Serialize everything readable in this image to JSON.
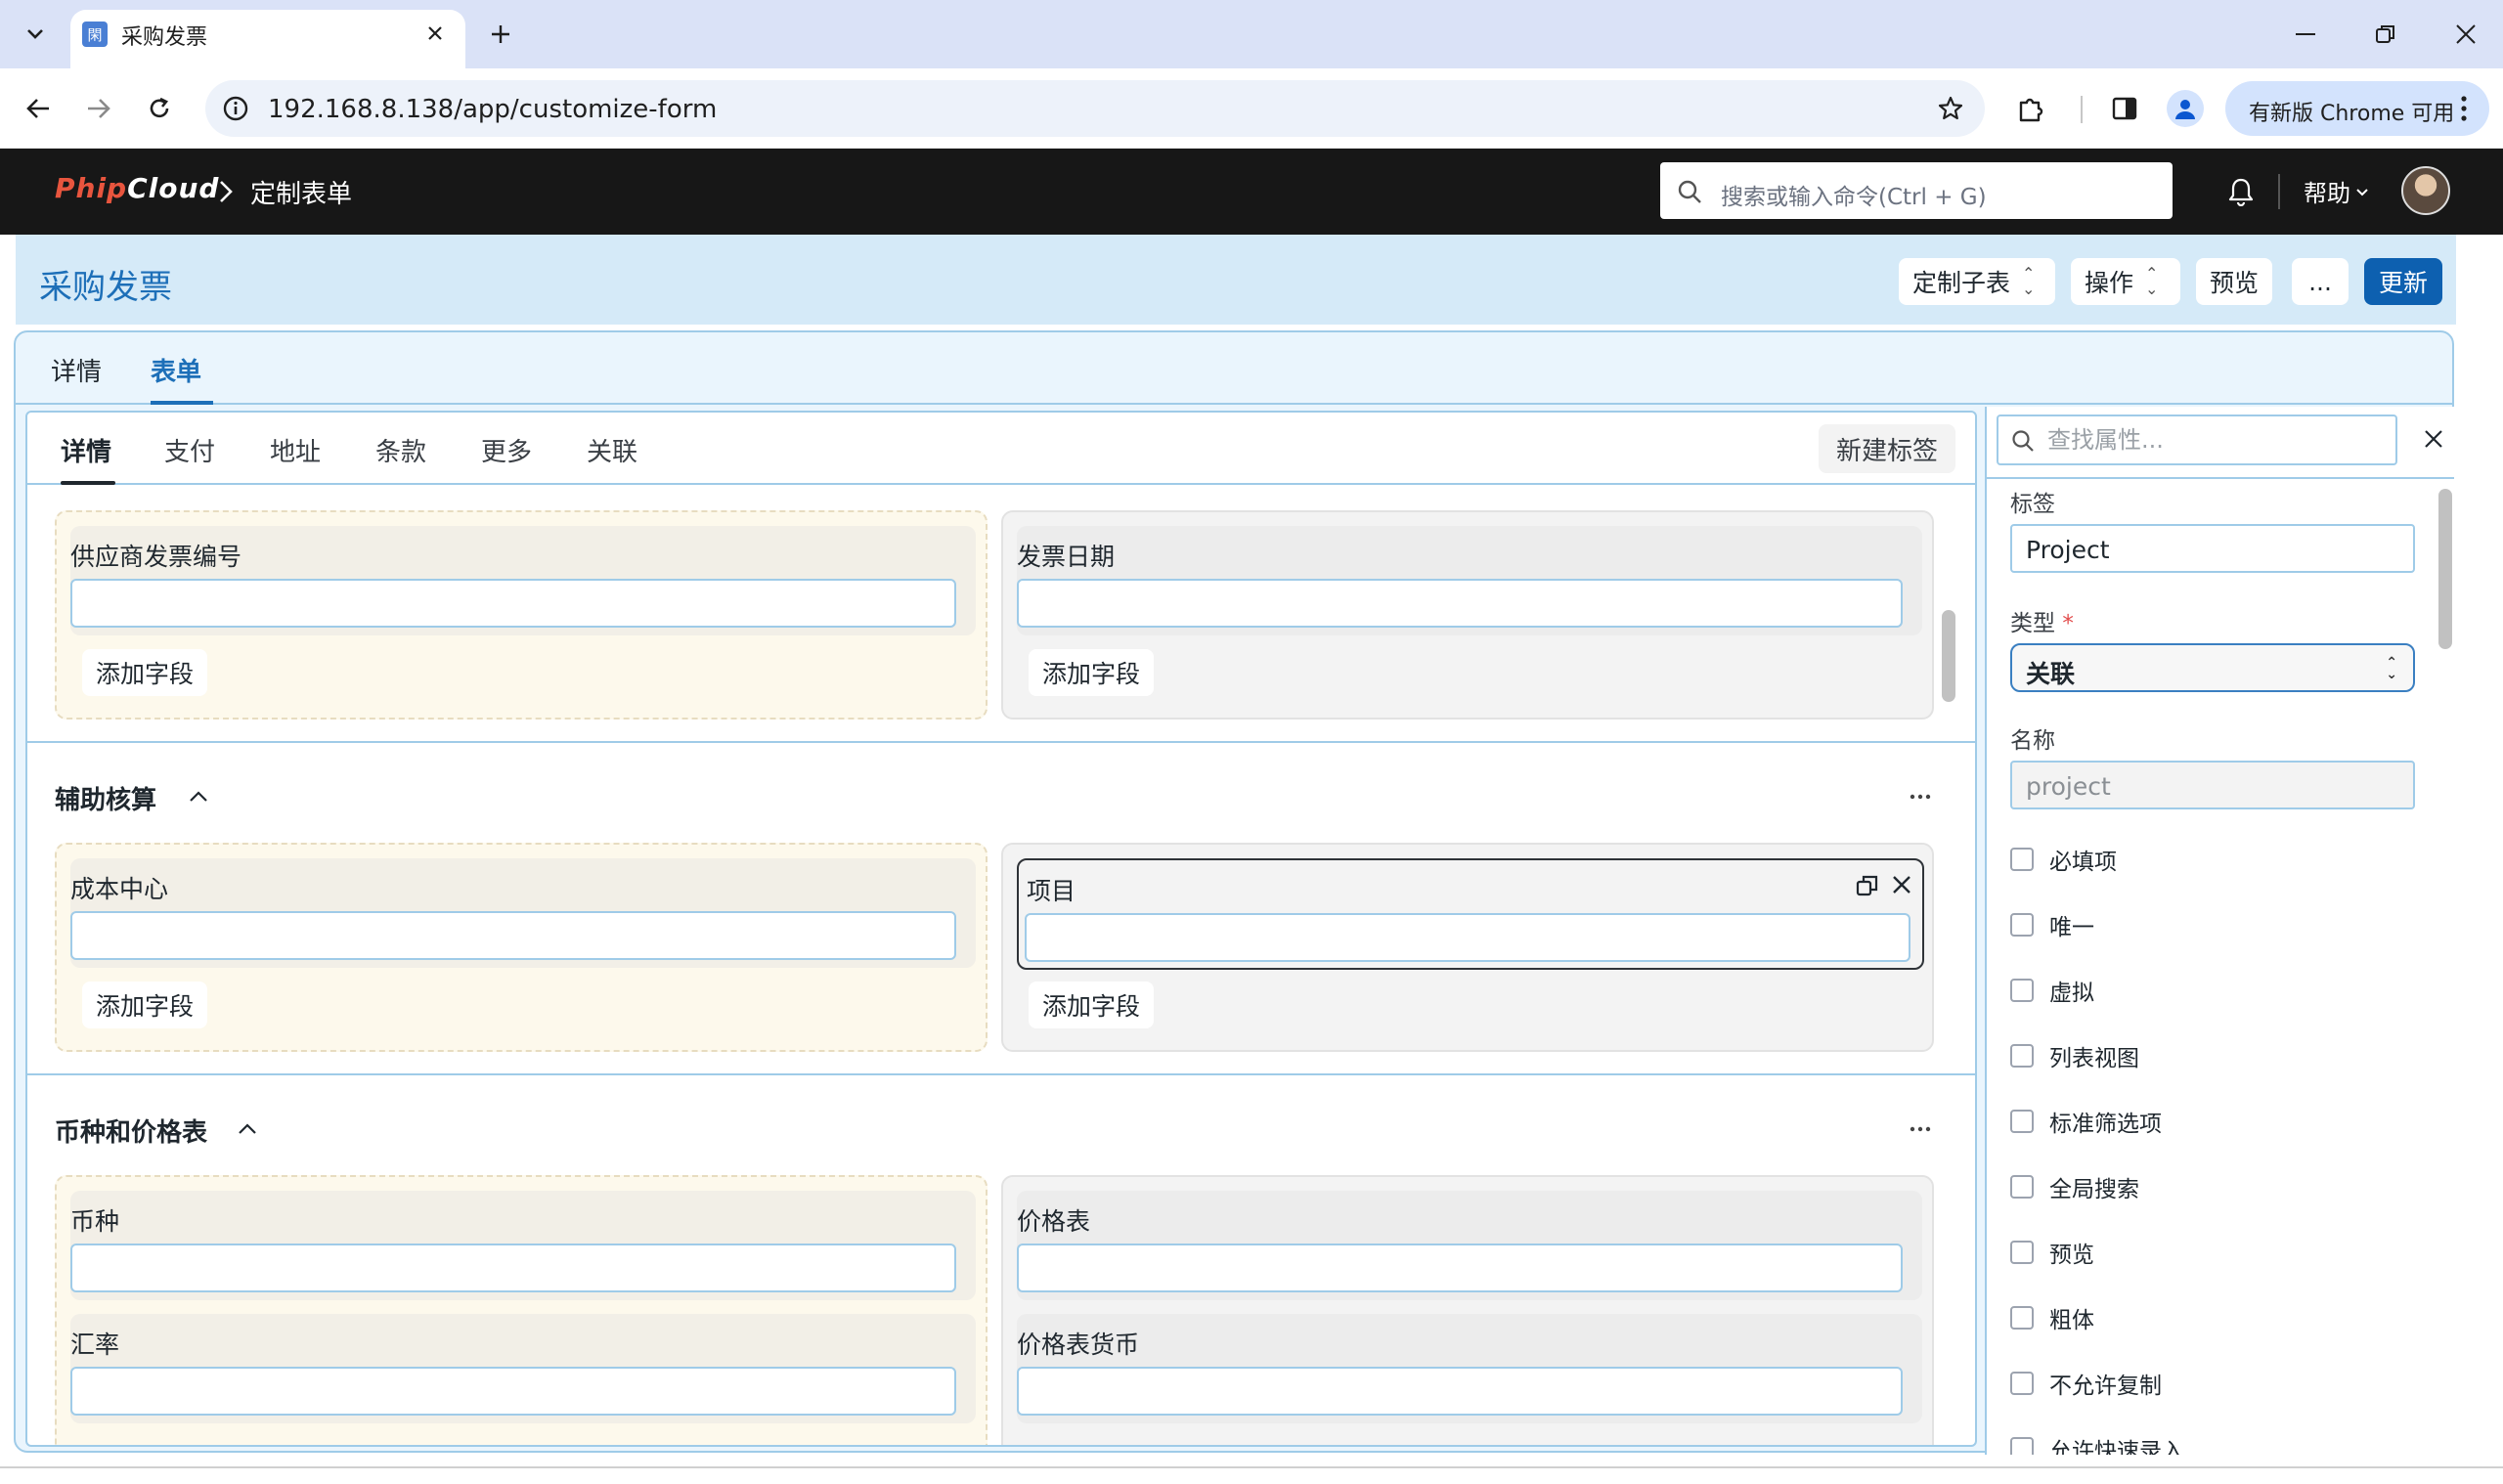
{
  "browser": {
    "tab_title": "采购发票",
    "favicon_glyph": "閑",
    "url": "192.168.8.138/app/customize-form",
    "update_label": "有新版 Chrome 可用"
  },
  "navbar": {
    "logo_part1": "Phip",
    "logo_part2": "Cloud",
    "breadcrumb": "定制表单",
    "search_placeholder": "搜索或输入命令(Ctrl + G)",
    "help_label": "帮助"
  },
  "page": {
    "title": "采购发票",
    "buttons": {
      "customize_child": "定制子表",
      "actions": "操作",
      "preview": "预览",
      "more": "...",
      "update": "更新"
    },
    "top_tabs": [
      "详情",
      "表单"
    ],
    "form_tabs": [
      "详情",
      "支付",
      "地址",
      "条款",
      "更多",
      "关联"
    ],
    "new_tab_label": "新建标签"
  },
  "form": {
    "add_field_label": "添加字段",
    "section1": {
      "left_fields": [
        "供应商发票编号"
      ],
      "right_fields": [
        "发票日期"
      ]
    },
    "section2": {
      "title": "辅助核算",
      "left_fields": [
        "成本中心"
      ],
      "right_fields": [
        "项目"
      ]
    },
    "section3": {
      "title": "币种和价格表",
      "left_fields": [
        "币种",
        "汇率"
      ],
      "right_fields": [
        "价格表",
        "价格表货币"
      ]
    }
  },
  "properties": {
    "search_placeholder": "查找属性...",
    "label_title": "标签",
    "label_value": "Project",
    "type_title": "类型",
    "required_mark": "*",
    "type_value": "关联",
    "name_title": "名称",
    "name_value": "project",
    "checkboxes": [
      "必填项",
      "唯一",
      "虚拟",
      "列表视图",
      "标准筛选项",
      "全局搜索",
      "预览",
      "粗体",
      "不允许复制",
      "允许快速录入"
    ]
  },
  "colors": {
    "accent": "#1d6fb8",
    "primary_button": "#0d60b0",
    "page_header_bg": "#d5eaf8",
    "navbar_bg": "#171717",
    "border_blue": "#9fcbe8"
  }
}
